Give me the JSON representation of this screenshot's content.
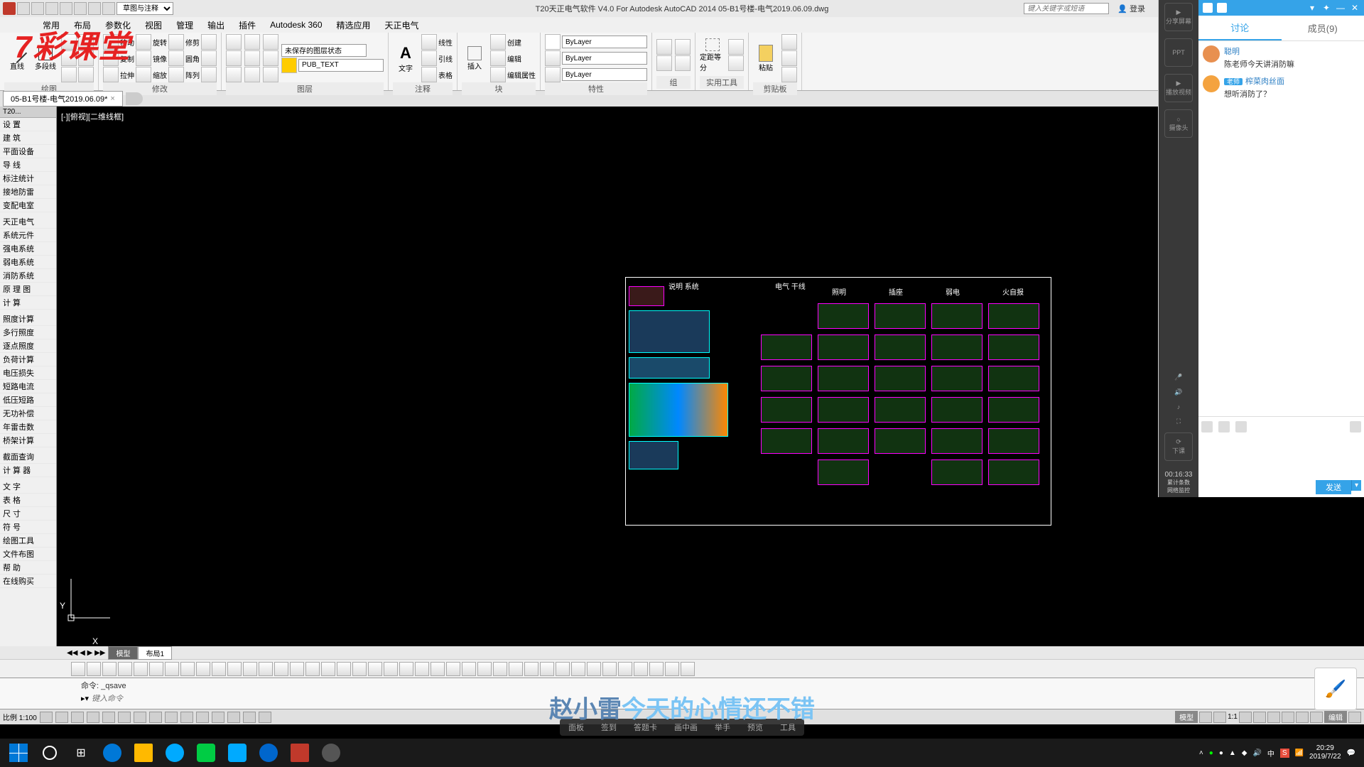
{
  "titlebar": {
    "workspace": "草图与注释",
    "title": "T20天正电气软件 V4.0 For Autodesk AutoCAD 2014   05-B1号楼-电气2019.06.09.dwg",
    "search_placeholder": "键入关键字或短语",
    "login": "登录"
  },
  "menus": [
    "常用",
    "布局",
    "参数化",
    "视图",
    "管理",
    "输出",
    "插件",
    "Autodesk 360",
    "精选应用",
    "天正电气"
  ],
  "ribbon": {
    "groups": [
      "绘图",
      "修改",
      "图层",
      "注释",
      "块",
      "特性",
      "组",
      "实用工具",
      "剪贴板"
    ],
    "draw": {
      "line": "直线",
      "polyline": "多段线"
    },
    "modify": {
      "move": "移动",
      "rotate": "旋转",
      "trim": "修剪",
      "copy": "复制",
      "mirror": "镜像",
      "fillet": "圆角",
      "stretch": "拉伸",
      "scale": "缩放",
      "array": "阵列"
    },
    "layer_state": "未保存的图层状态",
    "layer_name": "PUB_TEXT",
    "annot": {
      "text": "文字",
      "linedr": "线性",
      "leader": "引线",
      "table": "表格"
    },
    "block": {
      "insert": "插入",
      "create": "创建",
      "edit": "编辑",
      "edit_attr": "编辑属性"
    },
    "props": {
      "bylayer": "ByLayer"
    },
    "group": {
      "group": "组"
    },
    "util": {
      "measure": "定距等分"
    },
    "clip": {
      "paste": "粘贴"
    }
  },
  "filetab": {
    "name": "05-B1号楼-电气2019.06.09*"
  },
  "palette": {
    "title": "T20...",
    "items1": [
      "设    置",
      "建    筑",
      "平面设备",
      "导    线",
      "标注统计",
      "接地防雷",
      "变配电室"
    ],
    "items2": [
      "天正电气",
      "系统元件",
      "强电系统",
      "弱电系统",
      "消防系统",
      "原 理 图",
      "计    算"
    ],
    "items3": [
      "照度计算",
      "多行照度",
      "逐点照度",
      "负荷计算",
      "电压损失",
      "短路电流",
      "低压短路",
      "无功补偿",
      "年雷击数",
      "桥架计算"
    ],
    "items4": [
      "截面查询",
      "计 算 器"
    ],
    "items5": [
      "文    字",
      "表    格",
      "尺    寸",
      "符    号",
      "绘图工具",
      "文件布图",
      "帮    助",
      "在线购买"
    ]
  },
  "viewport": "[-][俯视][二维线框]",
  "drawing_headers": [
    "说明\n系统",
    "电气\n干线",
    "照明",
    "插座",
    "弱电",
    "火自报"
  ],
  "model_tabs": [
    "模型",
    "布局1"
  ],
  "cmd": {
    "history": "命令: _qsave",
    "prompt": "键入命令"
  },
  "status": {
    "scale": "比例 1:100",
    "right_label": "模型",
    "annot": "1:1",
    "edit": "编辑"
  },
  "watermark": "7彩课堂",
  "subtitle": {
    "part1": "赵小雷",
    "part2": "今天的心情还不错"
  },
  "chat": {
    "tabs": [
      "讨论",
      "成员(9)"
    ],
    "sidebar": [
      "分享屏幕",
      "PPT",
      "播放视频",
      "摄像头"
    ],
    "timer": "00:16:33",
    "stats": "累计条数",
    "net": "网络监控",
    "bottom": "下课",
    "msgs": [
      {
        "user": "聪明",
        "text": "陈老师今天讲消防嘛"
      },
      {
        "badge": "老师",
        "user": "榨菜肉丝面",
        "text": "想听消防了？"
      }
    ],
    "send": "发送"
  },
  "edu_toolbar": [
    "面板",
    "签到",
    "答题卡",
    "画中画",
    "举手",
    "预览",
    "工具"
  ],
  "taskbar": {
    "time": "20:29",
    "date": "2019/7/22"
  }
}
